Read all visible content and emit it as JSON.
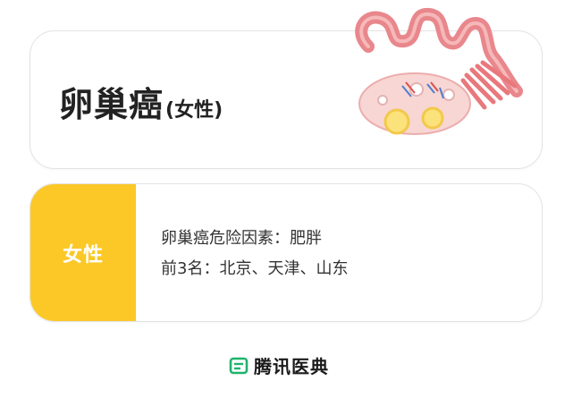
{
  "title_card": {
    "title": "卵巢癌",
    "subtitle": "(女性)",
    "illustration": "ovary-illustration"
  },
  "info_card": {
    "tag": "女性",
    "tag_color": "#fbc827",
    "line1": "卵巢癌危险因素：肥胖",
    "line2": "前3名：北京、天津、山东"
  },
  "footer": {
    "brand": "腾讯医典",
    "logo_icon": "tencent-medipedia-logo-icon",
    "brand_color": "#1fb36b"
  }
}
